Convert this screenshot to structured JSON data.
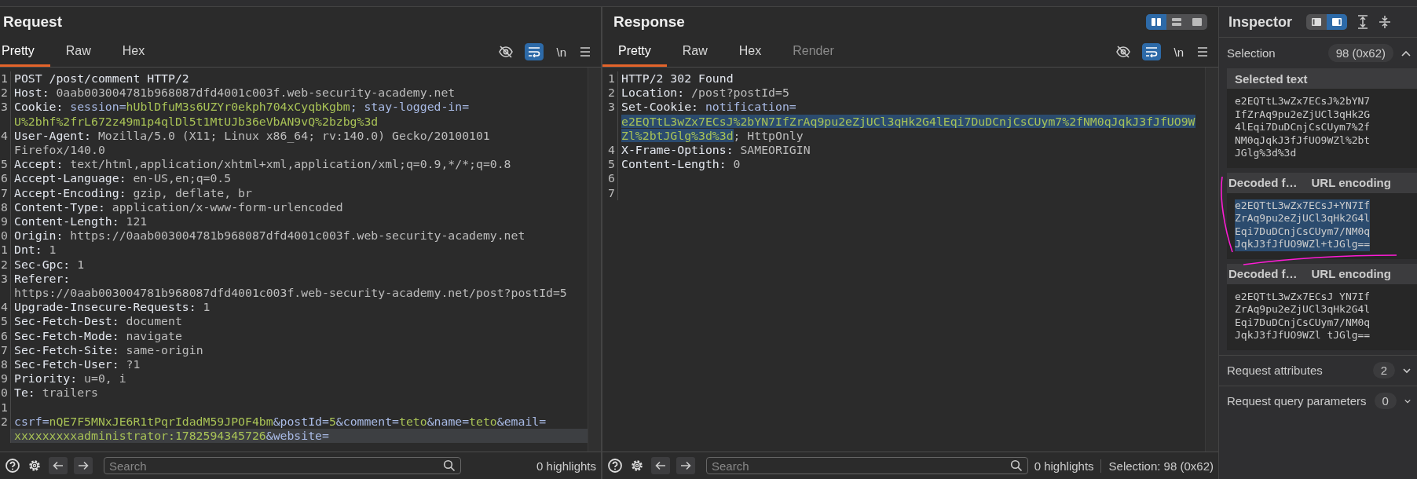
{
  "request": {
    "title": "Request",
    "tabs": [
      {
        "label": "Pretty",
        "selected": true,
        "disabled": false
      },
      {
        "label": "Raw",
        "selected": false,
        "disabled": false
      },
      {
        "label": "Hex",
        "selected": false,
        "disabled": false
      }
    ],
    "toolbar": {
      "wrap_lines": true,
      "newline_label": "\\n"
    },
    "lines": [
      {
        "number": "1",
        "current": false,
        "rows": [
          [
            {
              "kind": "key",
              "text": "POST /post/comment HTTP/2"
            }
          ]
        ]
      },
      {
        "number": "2",
        "current": false,
        "rows": [
          [
            {
              "kind": "key",
              "text": "Host: "
            },
            {
              "kind": "value",
              "text": "0aab003004781b968087dfd4001c003f.web-security-academy.net"
            }
          ]
        ]
      },
      {
        "number": "3",
        "current": false,
        "rows": [
          [
            {
              "kind": "key",
              "text": "Cookie: "
            },
            {
              "kind": "param",
              "text": "session="
            },
            {
              "kind": "token",
              "text": "hUblDfuM3s6UZYr0ekph704xCyqbKgbm"
            },
            {
              "kind": "param",
              "text": "; stay-logged-in="
            }
          ],
          [
            {
              "kind": "token",
              "text": "U%2bhf%2frL672z49m1p4qlDl5t1MtUJb36eVbAN9vQ%2bzbg%3d"
            }
          ]
        ]
      },
      {
        "number": "4",
        "current": false,
        "rows": [
          [
            {
              "kind": "key",
              "text": "User-Agent: "
            },
            {
              "kind": "value",
              "text": "Mozilla/5.0 (X11; Linux x86_64; rv:140.0) Gecko/20100101"
            }
          ],
          [
            {
              "kind": "value",
              "text": "Firefox/140.0"
            }
          ]
        ]
      },
      {
        "number": "5",
        "current": false,
        "rows": [
          [
            {
              "kind": "key",
              "text": "Accept: "
            },
            {
              "kind": "value",
              "text": "text/html,application/xhtml+xml,application/xml;q=0.9,*/*;q=0.8"
            }
          ]
        ]
      },
      {
        "number": "6",
        "current": false,
        "rows": [
          [
            {
              "kind": "key",
              "text": "Accept-Language: "
            },
            {
              "kind": "value",
              "text": "en-US,en;q=0.5"
            }
          ]
        ]
      },
      {
        "number": "7",
        "current": false,
        "rows": [
          [
            {
              "kind": "key",
              "text": "Accept-Encoding: "
            },
            {
              "kind": "value",
              "text": "gzip, deflate, br"
            }
          ]
        ]
      },
      {
        "number": "8",
        "current": false,
        "rows": [
          [
            {
              "kind": "key",
              "text": "Content-Type: "
            },
            {
              "kind": "value",
              "text": "application/x-www-form-urlencoded"
            }
          ]
        ]
      },
      {
        "number": "9",
        "current": false,
        "rows": [
          [
            {
              "kind": "key",
              "text": "Content-Length: "
            },
            {
              "kind": "value",
              "text": "121"
            }
          ]
        ]
      },
      {
        "number": "0",
        "current": false,
        "rows": [
          [
            {
              "kind": "key",
              "text": "Origin: "
            },
            {
              "kind": "value",
              "text": "https://0aab003004781b968087dfd4001c003f.web-security-academy.net"
            }
          ]
        ]
      },
      {
        "number": "1",
        "current": false,
        "rows": [
          [
            {
              "kind": "key",
              "text": "Dnt: "
            },
            {
              "kind": "value",
              "text": "1"
            }
          ]
        ]
      },
      {
        "number": "2",
        "current": false,
        "rows": [
          [
            {
              "kind": "key",
              "text": "Sec-Gpc: "
            },
            {
              "kind": "value",
              "text": "1"
            }
          ]
        ]
      },
      {
        "number": "3",
        "current": false,
        "rows": [
          [
            {
              "kind": "key",
              "text": "Referer: "
            }
          ],
          [
            {
              "kind": "value",
              "text": "https://0aab003004781b968087dfd4001c003f.web-security-academy.net/post?postId=5"
            }
          ]
        ]
      },
      {
        "number": "4",
        "current": false,
        "rows": [
          [
            {
              "kind": "key",
              "text": "Upgrade-Insecure-Requests: "
            },
            {
              "kind": "value",
              "text": "1"
            }
          ]
        ]
      },
      {
        "number": "5",
        "current": false,
        "rows": [
          [
            {
              "kind": "key",
              "text": "Sec-Fetch-Dest: "
            },
            {
              "kind": "value",
              "text": "document"
            }
          ]
        ]
      },
      {
        "number": "6",
        "current": false,
        "rows": [
          [
            {
              "kind": "key",
              "text": "Sec-Fetch-Mode: "
            },
            {
              "kind": "value",
              "text": "navigate"
            }
          ]
        ]
      },
      {
        "number": "7",
        "current": false,
        "rows": [
          [
            {
              "kind": "key",
              "text": "Sec-Fetch-Site: "
            },
            {
              "kind": "value",
              "text": "same-origin"
            }
          ]
        ]
      },
      {
        "number": "8",
        "current": false,
        "rows": [
          [
            {
              "kind": "key",
              "text": "Sec-Fetch-User: "
            },
            {
              "kind": "value",
              "text": "?1"
            }
          ]
        ]
      },
      {
        "number": "9",
        "current": false,
        "rows": [
          [
            {
              "kind": "key",
              "text": "Priority: "
            },
            {
              "kind": "value",
              "text": "u=0, i"
            }
          ]
        ]
      },
      {
        "number": "0",
        "current": false,
        "rows": [
          [
            {
              "kind": "key",
              "text": "Te: "
            },
            {
              "kind": "value",
              "text": "trailers"
            }
          ]
        ]
      },
      {
        "number": "1",
        "current": false,
        "rows": [
          []
        ]
      },
      {
        "number": "2",
        "current": true,
        "rows": [
          [
            {
              "kind": "param",
              "text": "csrf="
            },
            {
              "kind": "token",
              "text": "nQE7F5MNxJE6R1tPqrIdadM59JPOF4bm"
            },
            {
              "kind": "param",
              "text": "&postId="
            },
            {
              "kind": "token",
              "text": "5"
            },
            {
              "kind": "param",
              "text": "&comment="
            },
            {
              "kind": "token",
              "text": "teto"
            },
            {
              "kind": "param",
              "text": "&name="
            },
            {
              "kind": "token",
              "text": "teto"
            },
            {
              "kind": "param",
              "text": "&email="
            }
          ],
          [
            {
              "kind": "token",
              "text": "xxxxxxxxxadministrator:1782594345726"
            },
            {
              "kind": "param",
              "text": "&website="
            }
          ]
        ]
      }
    ],
    "bottom_bar": {
      "placeholder": "Search",
      "highlights": "0 highlights"
    }
  },
  "response": {
    "title": "Response",
    "layout_buttons": [
      {
        "kind": "split-columns",
        "selected": true
      },
      {
        "kind": "split-rows",
        "selected": false
      },
      {
        "kind": "single",
        "selected": false
      }
    ],
    "tabs": [
      {
        "label": "Pretty",
        "selected": true,
        "disabled": false
      },
      {
        "label": "Raw",
        "selected": false,
        "disabled": false
      },
      {
        "label": "Hex",
        "selected": false,
        "disabled": false
      },
      {
        "label": "Render",
        "selected": false,
        "disabled": true
      }
    ],
    "toolbar": {
      "wrap_lines": true,
      "newline_label": "\\n"
    },
    "lines": [
      {
        "number": "1",
        "current": false,
        "rows": [
          [
            {
              "kind": "key",
              "text": "HTTP/2 302 Found"
            }
          ]
        ]
      },
      {
        "number": "2",
        "current": false,
        "rows": [
          [
            {
              "kind": "key",
              "text": "Location: "
            },
            {
              "kind": "value",
              "text": "/post?postId=5"
            }
          ]
        ]
      },
      {
        "number": "3",
        "current": false,
        "rows": [
          [
            {
              "kind": "key",
              "text": "Set-Cookie: "
            },
            {
              "kind": "param",
              "text": "notification="
            }
          ],
          [
            {
              "kind": "selected-token",
              "text": "e2EQTtL3wZx7ECsJ%2bYN7IfZrAq9pu2eZjUCl3qHk2G4lEqi7DuDCnjCsCUym7%2fNM0qJqkJ3fJfUO9W"
            }
          ],
          [
            {
              "kind": "selected-token",
              "text": "Zl%2btJGlg%3d%3d"
            },
            {
              "kind": "value",
              "text": "; HttpOnly"
            }
          ]
        ]
      },
      {
        "number": "4",
        "current": false,
        "rows": [
          [
            {
              "kind": "key",
              "text": "X-Frame-Options: "
            },
            {
              "kind": "value",
              "text": "SAMEORIGIN"
            }
          ]
        ]
      },
      {
        "number": "5",
        "current": false,
        "rows": [
          [
            {
              "kind": "key",
              "text": "Content-Length: "
            },
            {
              "kind": "value",
              "text": "0"
            }
          ]
        ]
      },
      {
        "number": "6",
        "current": false,
        "rows": [
          []
        ]
      },
      {
        "number": "7",
        "current": false,
        "rows": [
          []
        ]
      }
    ],
    "bottom_bar": {
      "placeholder": "Search",
      "highlights": "0 highlights",
      "selection": "Selection: 98 (0x62)"
    }
  },
  "inspector": {
    "title": "Inspector",
    "view_buttons": [
      {
        "kind": "sidebar-left",
        "selected": false
      },
      {
        "kind": "sidebar-right",
        "selected": true
      }
    ],
    "selection": {
      "label": "Selection",
      "value": "98 (0x62)"
    },
    "selected_text": {
      "title": "Selected text",
      "text": "e2EQTtL3wZx7ECsJ%2bYN7IfZrAq9pu2eZjUCl3qHk2G4lEqi7DuDCnjCsCUym7%2fNM0qJqkJ3fJfUO9WZl%2btJGlg%3d%3d"
    },
    "decoders": [
      {
        "title": "Decoded f…",
        "encoding": "URL encoding",
        "selected": true,
        "text": "e2EQTtL3wZx7ECsJ+YN7IfZrAq9pu2eZjUCl3qHk2G4lEqi7DuDCnjCsCUym7/NM0qJqkJ3fJfUO9WZl+tJGlg=="
      },
      {
        "title": "Decoded f…",
        "encoding": "URL encoding",
        "selected": false,
        "text": "e2EQTtL3wZx7ECsJ YN7IfZrAq9pu2eZjUCl3qHk2G4lEqi7DuDCnjCsCUym7/NM0qJqkJ3fJfUO9WZl tJGlg=="
      }
    ],
    "groups": [
      {
        "label": "Request attributes",
        "count": "2"
      },
      {
        "label": "Request query parameters",
        "count": "0"
      }
    ]
  }
}
